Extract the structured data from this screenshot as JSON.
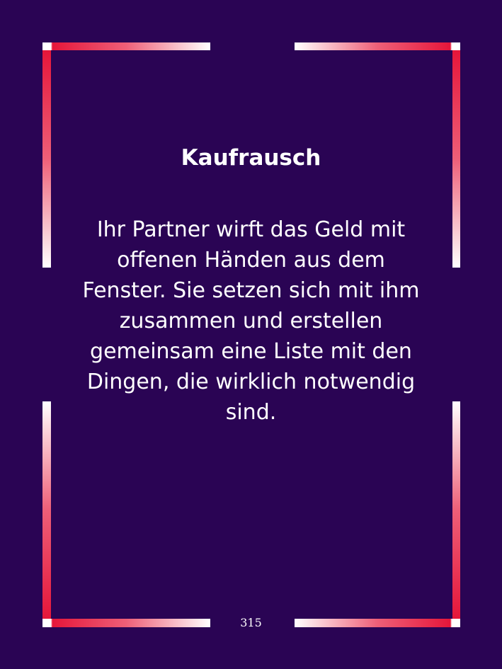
{
  "card": {
    "title": "Kaufrausch",
    "text": " Ihr Partner wirft das Geld mit\noffenen Händen aus dem\nFenster. Sie setzen sich mit ihm\nzusammen und erstellen\ngemeinsam eine Liste mit den\nDingen, die wirklich notwendig\nsind.",
    "page_number": "315"
  },
  "colors": {
    "background": "#2a0454",
    "frame_red": "#e5163a",
    "frame_white": "#ffffff",
    "text": "#ffffff"
  }
}
